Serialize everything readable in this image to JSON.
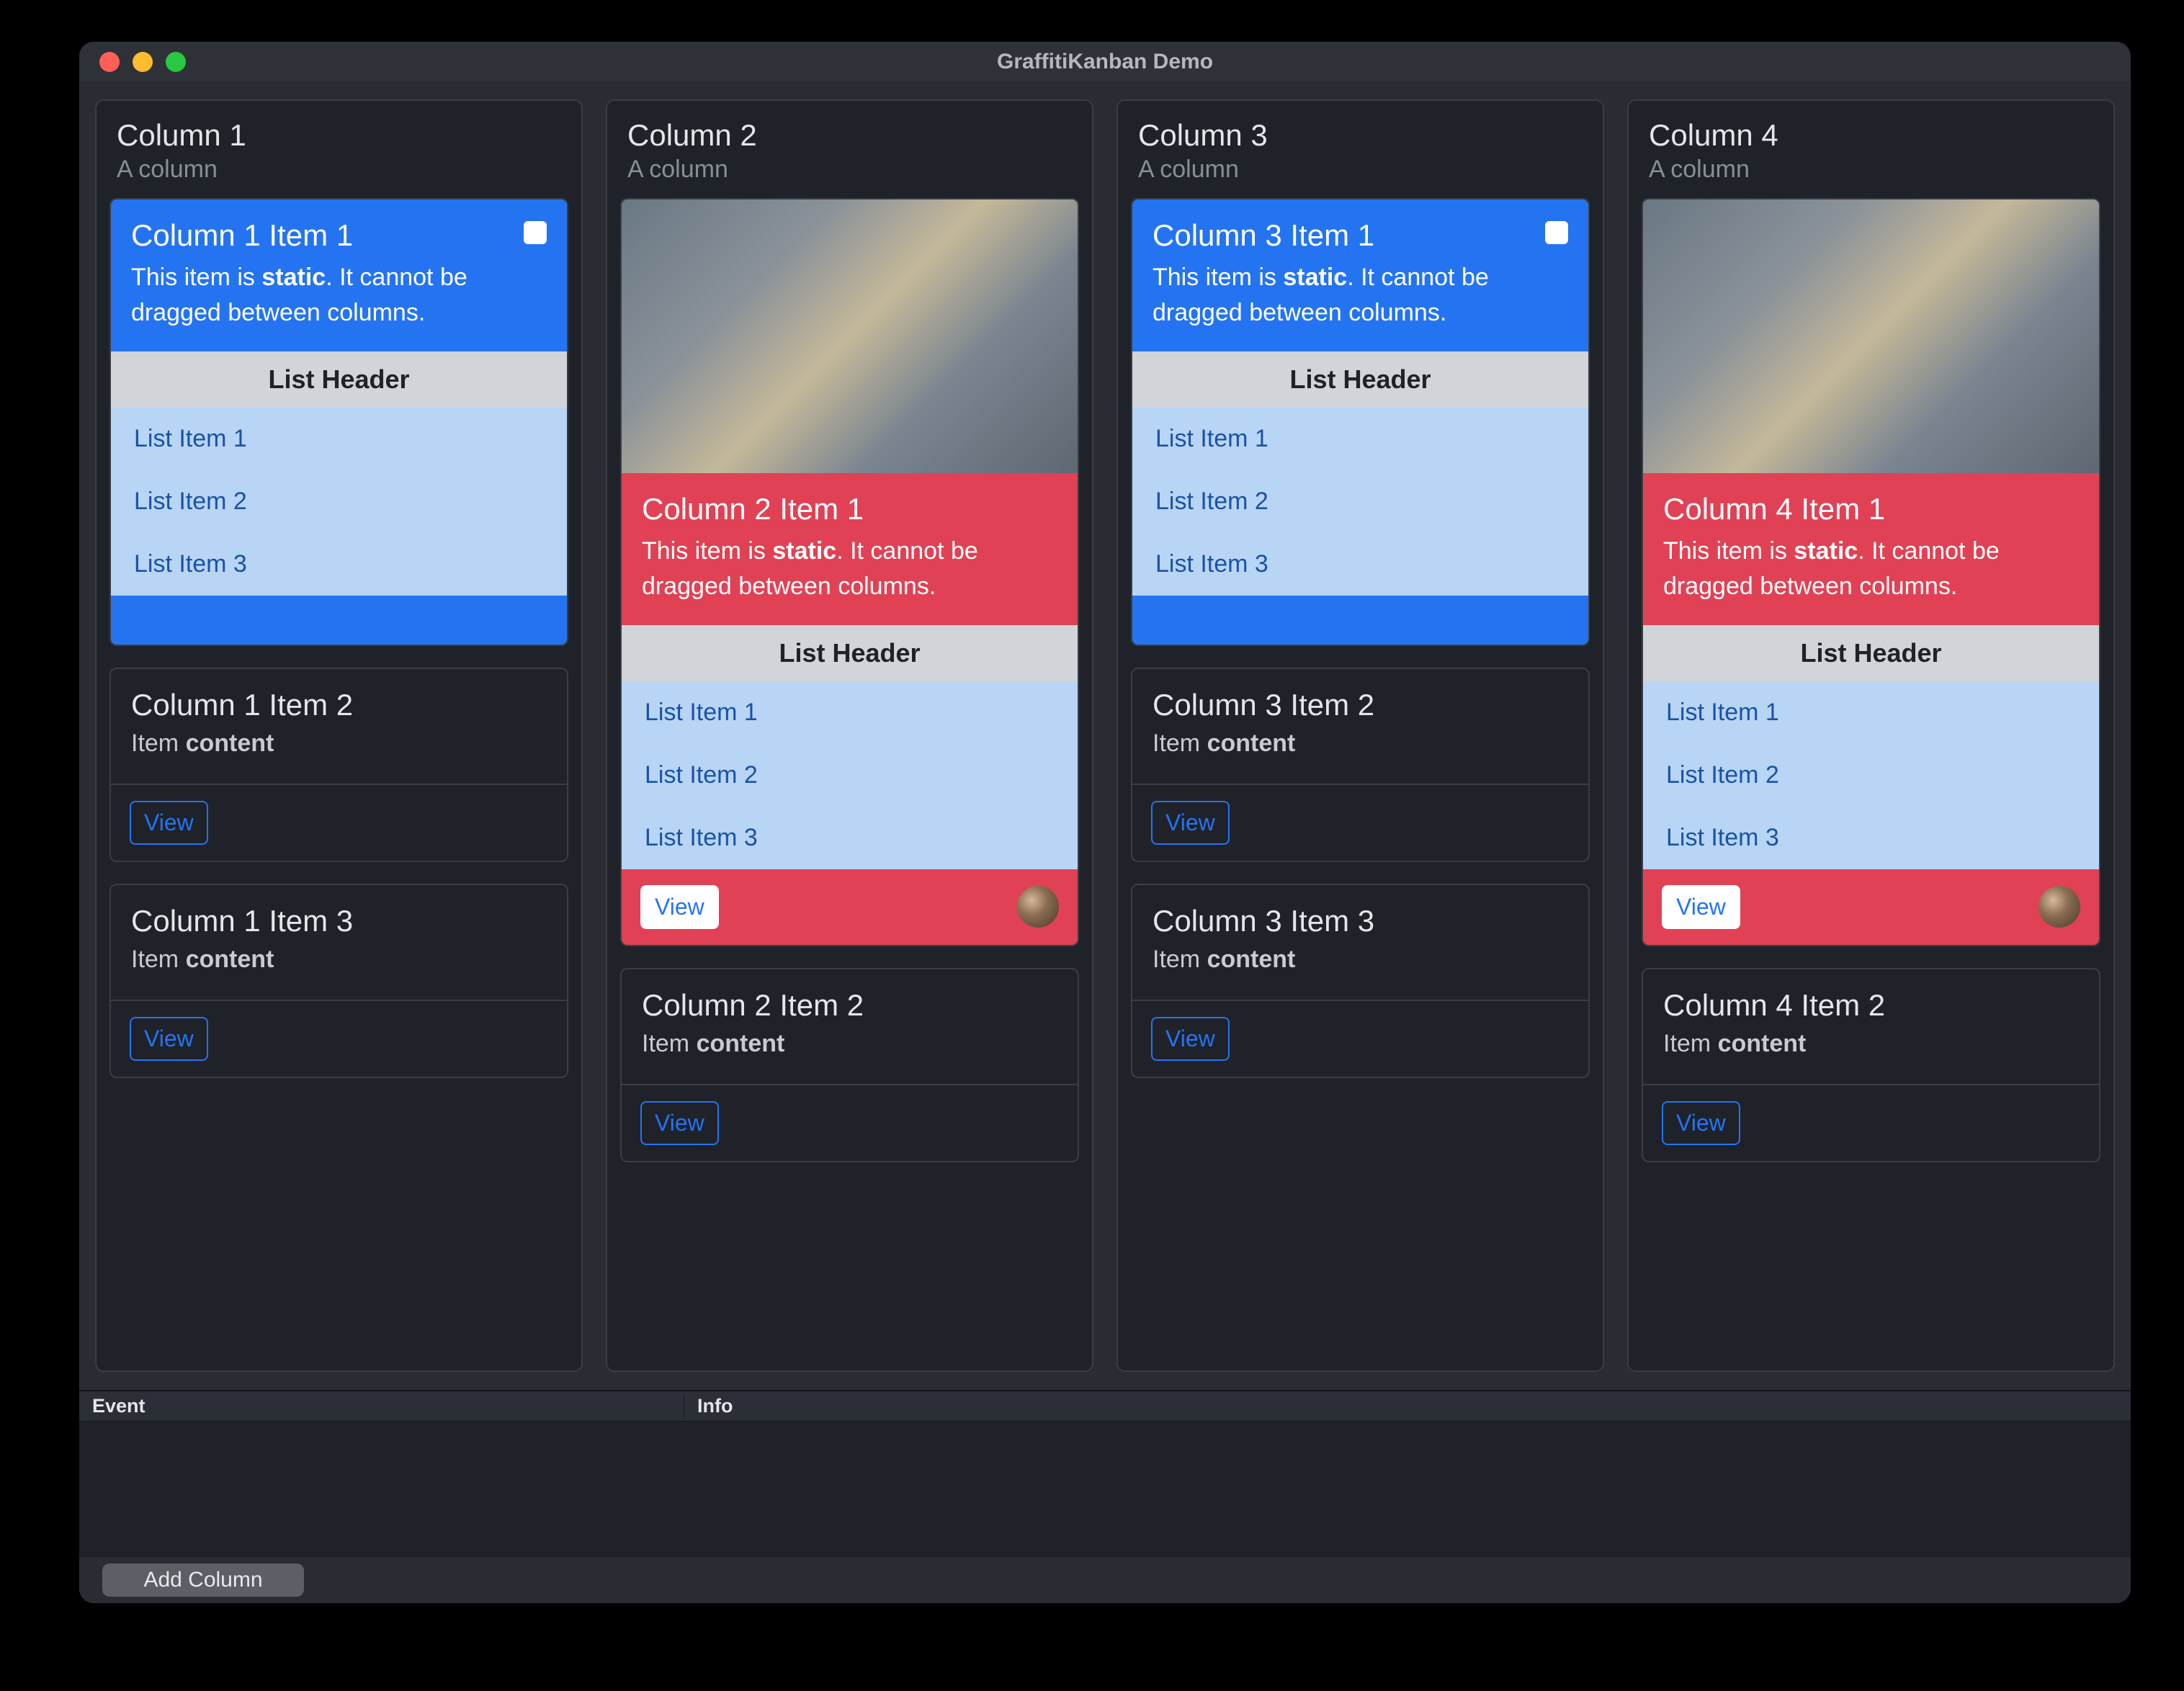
{
  "window": {
    "title": "GraffitiKanban Demo"
  },
  "buttons": {
    "view": "View",
    "add_column": "Add Column"
  },
  "grid": {
    "event_header": "Event",
    "info_header": "Info"
  },
  "static_desc": {
    "pre": "This item is ",
    "bold": "static",
    "post": ". It cannot be dragged between columns."
  },
  "item_content": {
    "pre": "Item ",
    "bold": "content"
  },
  "list": {
    "header": "List Header",
    "items": [
      "List Item 1",
      "List Item 2",
      "List Item 3"
    ]
  },
  "columns": [
    {
      "title": "Column 1",
      "subtitle": "A column",
      "cards": [
        {
          "type": "blue",
          "title": "Column 1 Item 1"
        },
        {
          "type": "dark",
          "title": "Column 1 Item 2"
        },
        {
          "type": "dark",
          "title": "Column 1 Item 3"
        }
      ]
    },
    {
      "title": "Column 2",
      "subtitle": "A column",
      "cards": [
        {
          "type": "red",
          "title": "Column 2 Item 1"
        },
        {
          "type": "dark",
          "title": "Column 2 Item 2"
        }
      ]
    },
    {
      "title": "Column 3",
      "subtitle": "A column",
      "cards": [
        {
          "type": "blue",
          "title": "Column 3 Item 1"
        },
        {
          "type": "dark",
          "title": "Column 3 Item 2"
        },
        {
          "type": "dark",
          "title": "Column 3 Item 3"
        }
      ]
    },
    {
      "title": "Column 4",
      "subtitle": "A column",
      "cards": [
        {
          "type": "red",
          "title": "Column 4 Item 1"
        },
        {
          "type": "dark",
          "title": "Column 4 Item 2"
        }
      ]
    }
  ]
}
